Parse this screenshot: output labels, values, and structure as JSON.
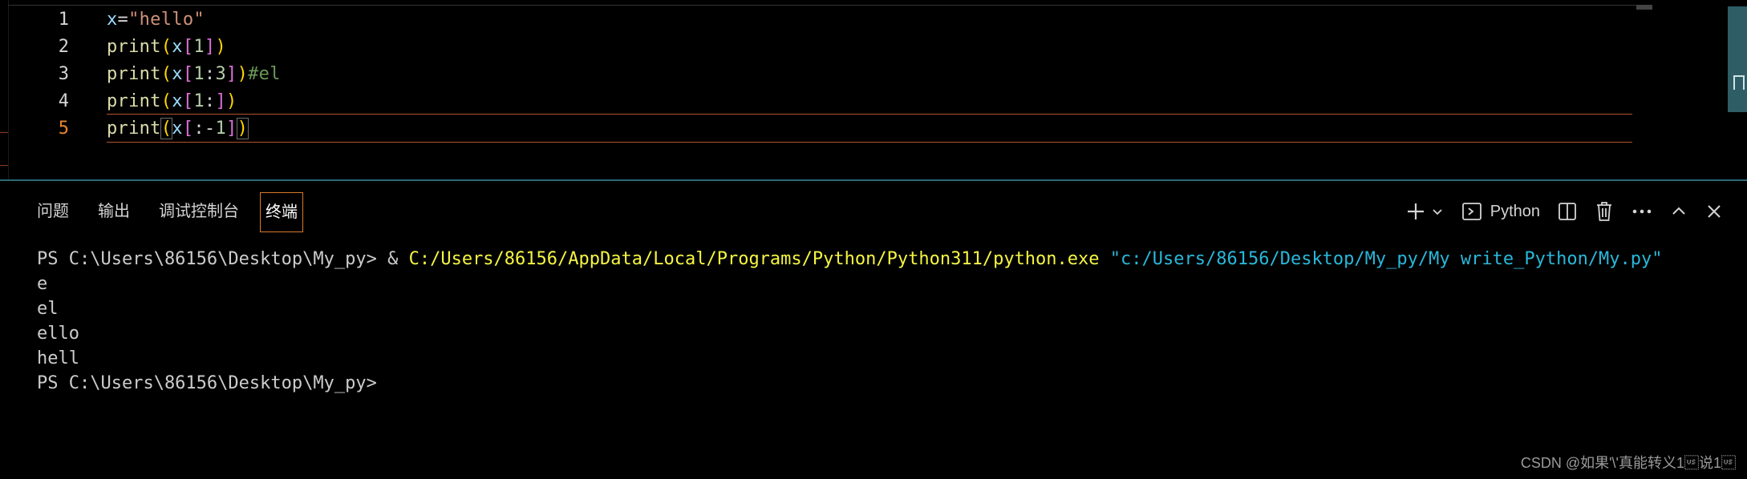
{
  "editor": {
    "lines": [
      {
        "num": "1",
        "tokens": [
          [
            "var",
            "x"
          ],
          [
            "op",
            "="
          ],
          [
            "str",
            "\"hello\""
          ]
        ]
      },
      {
        "num": "2",
        "tokens": [
          [
            "fn",
            "print"
          ],
          [
            "p1",
            "("
          ],
          [
            "var",
            "x"
          ],
          [
            "p2",
            "["
          ],
          [
            "num",
            "1"
          ],
          [
            "p2",
            "]"
          ],
          [
            "p1",
            ")"
          ]
        ]
      },
      {
        "num": "3",
        "tokens": [
          [
            "fn",
            "print"
          ],
          [
            "p1",
            "("
          ],
          [
            "var",
            "x"
          ],
          [
            "p2",
            "["
          ],
          [
            "num",
            "1"
          ],
          [
            "op",
            ":"
          ],
          [
            "num",
            "3"
          ],
          [
            "p2",
            "]"
          ],
          [
            "p1",
            ")"
          ],
          [
            "com",
            "#el"
          ]
        ]
      },
      {
        "num": "4",
        "tokens": [
          [
            "fn",
            "print"
          ],
          [
            "p1",
            "("
          ],
          [
            "var",
            "x"
          ],
          [
            "p2",
            "["
          ],
          [
            "num",
            "1"
          ],
          [
            "op",
            ":"
          ],
          [
            "p2",
            "]"
          ],
          [
            "p1",
            ")"
          ]
        ]
      },
      {
        "num": "5",
        "tokens": [
          [
            "fn",
            "print"
          ],
          [
            "p1b",
            "("
          ],
          [
            "var",
            "x"
          ],
          [
            "p2",
            "["
          ],
          [
            "op",
            ":"
          ],
          [
            "op",
            "-"
          ],
          [
            "num",
            "1"
          ],
          [
            "p2",
            "]"
          ],
          [
            "p1b",
            ")"
          ]
        ]
      }
    ],
    "active_line": 5,
    "colors": {
      "line_number_active": "#e8852a",
      "current_line_border": "#b5532c"
    }
  },
  "panel": {
    "tabs": [
      {
        "label": "问题"
      },
      {
        "label": "输出"
      },
      {
        "label": "调试控制台"
      },
      {
        "label": "终端",
        "active": true
      }
    ],
    "toolbar": {
      "new_terminal_icon": "plus-icon",
      "dropdown_icon": "chevron-down-icon",
      "profile_icon": "terminal-icon",
      "profile_label": "Python",
      "split_icon": "split-terminal-icon",
      "kill_icon": "trash-icon",
      "more_icon": "ellipsis-icon",
      "maximize_icon": "chevron-up-icon",
      "close_icon": "close-icon"
    },
    "terminal": {
      "prompt": "PS C:\\Users\\86156\\Desktop\\My_py>",
      "command_amp": "&",
      "command_exe": "C:/Users/86156/AppData/Local/Programs/Python/Python311/python.exe",
      "command_arg": "\"c:/Users/86156/Desktop/My_py/My write_Python/My.py\"",
      "output": [
        "e",
        "el",
        "ello",
        "hell"
      ],
      "final_prompt": "PS C:\\Users\\86156\\Desktop\\My_py>"
    }
  },
  "watermark": "CSDN @如果'\\'真能转义1\u001f说1\u001f"
}
